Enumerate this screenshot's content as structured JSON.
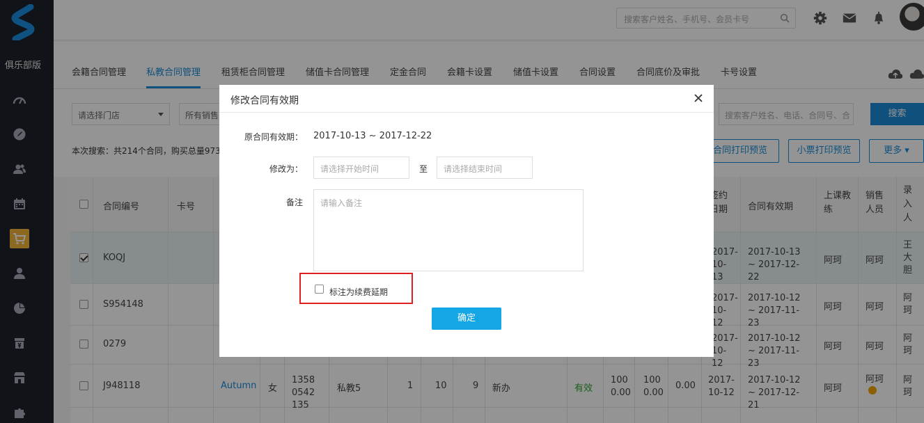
{
  "sidebar": {
    "club_label": "俱乐部版",
    "items": [
      {
        "icon": "dashboard-icon"
      },
      {
        "icon": "compass-icon"
      },
      {
        "icon": "members-icon"
      },
      {
        "icon": "calendar-icon"
      },
      {
        "icon": "shopping-cart-icon"
      },
      {
        "icon": "user-icon"
      },
      {
        "icon": "pie-chart-icon"
      },
      {
        "icon": "finance-icon"
      },
      {
        "icon": "store-icon"
      },
      {
        "icon": "puzzle-icon"
      }
    ]
  },
  "header": {
    "search_placeholder": "搜索客户姓名、手机号、会员卡号"
  },
  "tabs": [
    {
      "label": "会籍合同管理"
    },
    {
      "label": "私教合同管理"
    },
    {
      "label": "租赁柜合同管理"
    },
    {
      "label": "储值卡合同管理"
    },
    {
      "label": "定金合同"
    },
    {
      "label": "会籍卡设置"
    },
    {
      "label": "储值卡设置"
    },
    {
      "label": "合同设置"
    },
    {
      "label": "合同底价及审批"
    },
    {
      "label": "卡号设置"
    }
  ],
  "filters": {
    "store_select": "请选择门店",
    "sales_select": "所有销售",
    "search_placeholder": "搜索客户姓名、电话、合同号、合",
    "search_button": "搜索",
    "summary": "本次搜索：共214个合同，购买总量973",
    "print_contract": "合同打印预览",
    "print_receipt": "小票打印预览",
    "more": "更多"
  },
  "table": {
    "headers": {
      "contract_no": "合同编号",
      "card_no": "卡号",
      "sign_date": "签约日期",
      "valid_period": "合同有效期",
      "coach": "上课教练",
      "sales": "销售人员",
      "entry": "录入人"
    },
    "rows": [
      {
        "contract_no": "KOQJ",
        "checked": true,
        "sign_date": "2017-10-13",
        "valid_period": "2017-10-13 ~ 2017-12-22",
        "coach": "阿珂",
        "sales": "阿珂",
        "entry": "王大胆"
      },
      {
        "contract_no": "S954148",
        "checked": false,
        "sign_date": "2017-10-12",
        "valid_period": "2017-10-12 ~ 2017-11-23",
        "coach": "阿珂",
        "sales": "阿珂",
        "entry": "阿珂"
      },
      {
        "contract_no": "0279",
        "checked": false,
        "sign_date": "2017-10-12",
        "valid_period": "2017-10-12 ~ 2017-11-23",
        "coach": "阿珂",
        "sales": "阿珂",
        "entry": "阿珂"
      },
      {
        "contract_no": "J948118",
        "checked": false,
        "name": "Autumn",
        "gender": "女",
        "phone": "13580542135",
        "course": "私教5",
        "n1": "1",
        "n2": "10",
        "n3": "9",
        "type": "新办",
        "status": "有效",
        "amt1": "1000.00",
        "amt2": "1000.00",
        "amt3": "0.00",
        "sign_date": "2017-10-12",
        "valid_period": "2017-10-12 ~ 2017-12-21",
        "coach": "阿珂",
        "sales": "阿珂",
        "entry": "阿珂"
      }
    ]
  },
  "modal": {
    "title": "修改合同有效期",
    "original_label": "原合同有效期：",
    "original_value": "2017-10-13 ~ 2017-12-22",
    "modify_label": "修改为：",
    "start_placeholder": "请选择开始时间",
    "to_label": "至",
    "end_placeholder": "请选择结束时间",
    "remark_label": "备注",
    "remark_placeholder": "请输入备注",
    "renewal_checkbox_label": "标注为续费延期",
    "confirm_button": "确定"
  },
  "colors": {
    "sidebar_bg": "#1d232b",
    "accent": "#1a8bd6",
    "confirm": "#14a6e5",
    "highlight": "#e02020",
    "active_nav": "#f2b43a"
  }
}
